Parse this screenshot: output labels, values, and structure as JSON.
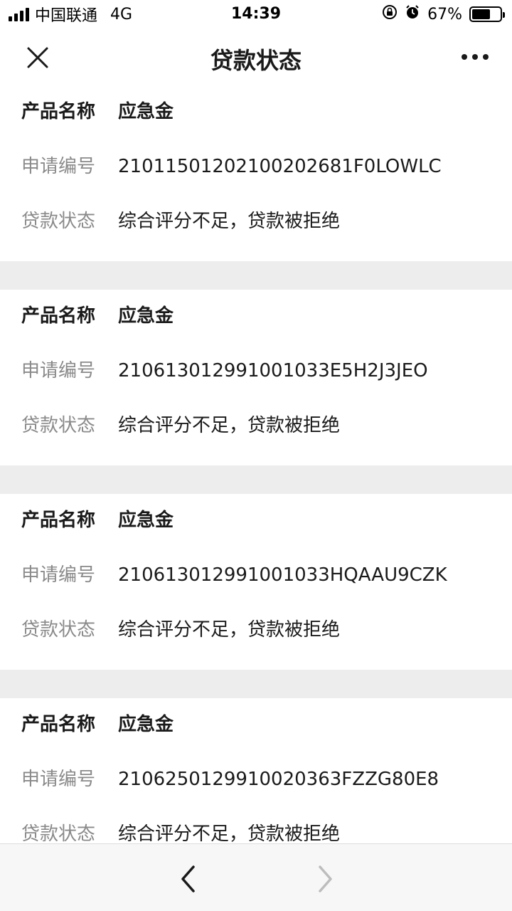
{
  "status_bar": {
    "carrier": "中国联通",
    "network": "4G",
    "time": "14:39",
    "battery": "67%",
    "battery_level": 0.67,
    "icons": [
      "signal-icon",
      "rotation-lock-icon",
      "alarm-icon",
      "battery-icon"
    ]
  },
  "nav": {
    "title": "贷款状态",
    "close_icon": "close-icon",
    "more_icon": "more-icon"
  },
  "loans": [
    {
      "product_label": "产品名称",
      "product": "应急金",
      "app_no_label": "申请编号",
      "app_no": "21011501202100202681F0LOWLC",
      "status_label": "贷款状态",
      "status": "综合评分不足，贷款被拒绝"
    },
    {
      "product_label": "产品名称",
      "product": "应急金",
      "app_no_label": "申请编号",
      "app_no": "210613012991001033E5H2J3JEO",
      "status_label": "贷款状态",
      "status": "综合评分不足，贷款被拒绝"
    },
    {
      "product_label": "产品名称",
      "product": "应急金",
      "app_no_label": "申请编号",
      "app_no": "210613012991001033HQAAU9CZK",
      "status_label": "贷款状态",
      "status": "综合评分不足，贷款被拒绝"
    },
    {
      "product_label": "产品名称",
      "product": "应急金",
      "app_no_label": "申请编号",
      "app_no": "21062501299100203 63FZZG80E8",
      "status_label": "贷款状态",
      "status": "综合评分不足，贷款被拒绝"
    }
  ],
  "toolbar": {
    "back_icon": "chevron-left-icon",
    "forward_icon": "chevron-right-icon",
    "colors": {
      "active": "#1a1a1a",
      "disabled": "#bdbdbd"
    }
  }
}
